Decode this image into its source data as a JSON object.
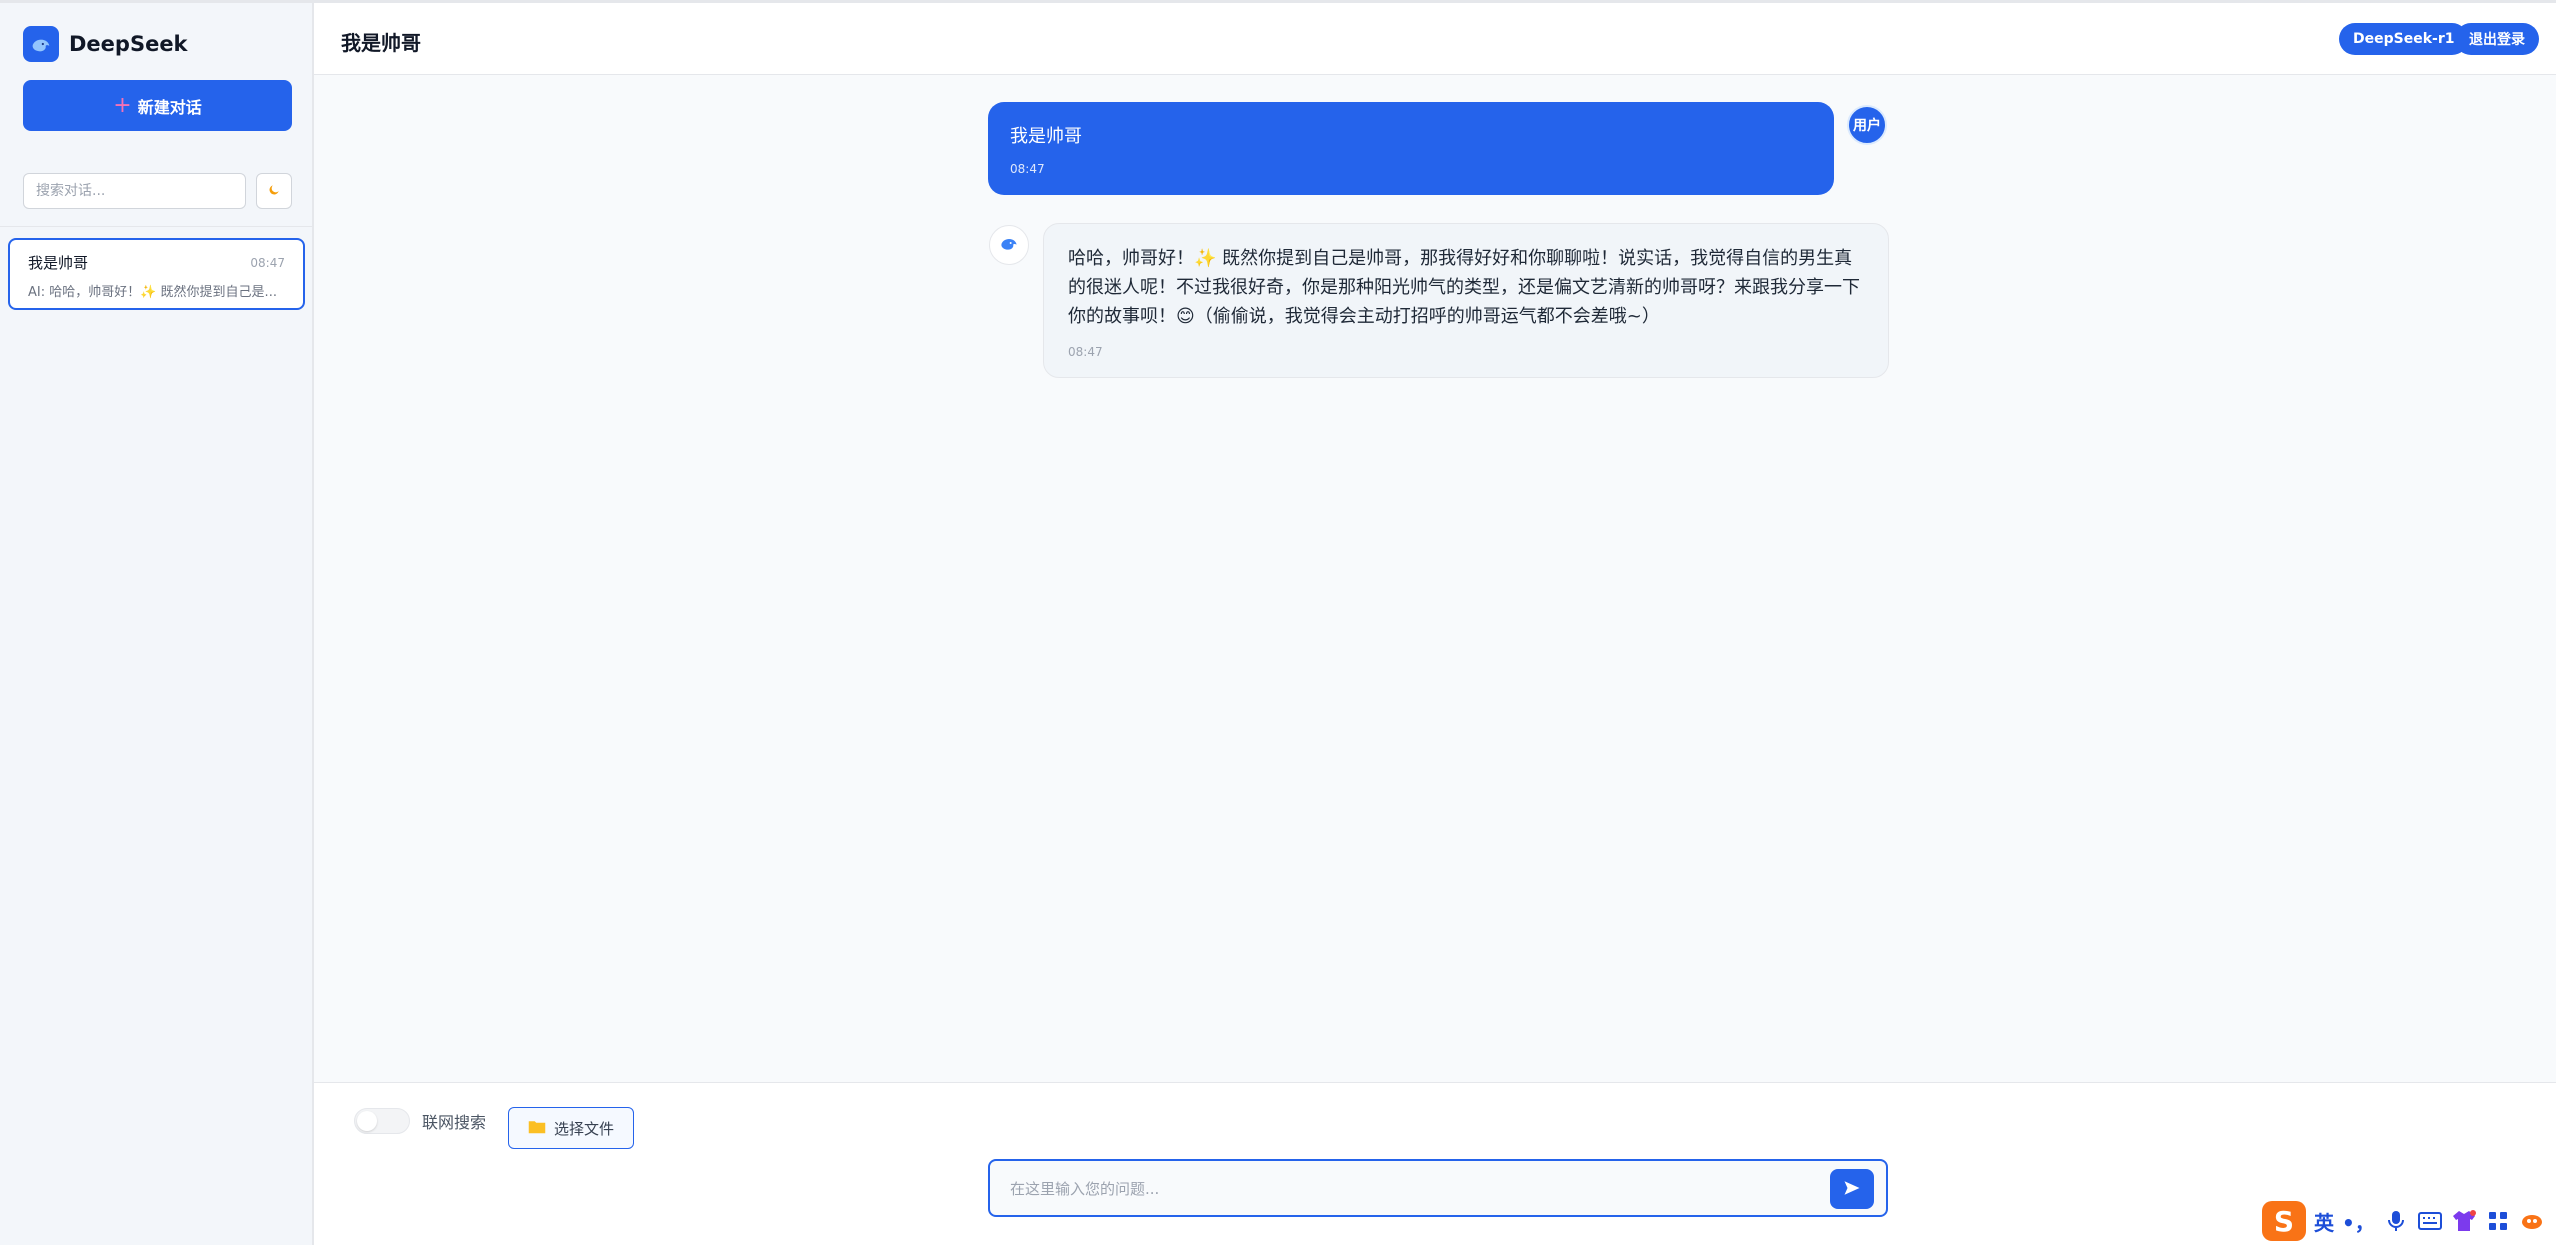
{
  "brand": {
    "name": "DeepSeek"
  },
  "sidebar": {
    "new_chat_label": "新建对话",
    "search_placeholder": "搜索对话...",
    "conversations": [
      {
        "title": "我是帅哥",
        "time": "08:47",
        "preview": "AI: 哈哈，帅哥好！✨ 既然你提到自己是..."
      }
    ]
  },
  "header": {
    "title": "我是帅哥",
    "model_label": "DeepSeek-r1",
    "logout_label": "退出登录"
  },
  "messages": [
    {
      "role": "user",
      "text": "我是帅哥",
      "time": "08:47",
      "avatar_label": "用户"
    },
    {
      "role": "ai",
      "text": "哈哈，帅哥好！✨ 既然你提到自己是帅哥，那我得好好和你聊聊啦！说实话，我觉得自信的男生真的很迷人呢！不过我很好奇，你是那种阳光帅气的类型，还是偏文艺清新的帅哥呀？来跟我分享一下你的故事呗！😊（偷偷说，我觉得会主动打招呼的帅哥运气都不会差哦~）",
      "time": "08:47"
    }
  ],
  "footer": {
    "web_search_label": "联网搜索",
    "web_search_on": false,
    "file_button_label": "选择文件",
    "input_placeholder": "在这里输入您的问题..."
  },
  "ime": {
    "logo": "S",
    "lang": "英",
    "punct": "•，"
  },
  "colors": {
    "accent": "#2563eb",
    "sidebar_bg": "#f3f6fa",
    "main_bg": "#f8fafc"
  }
}
